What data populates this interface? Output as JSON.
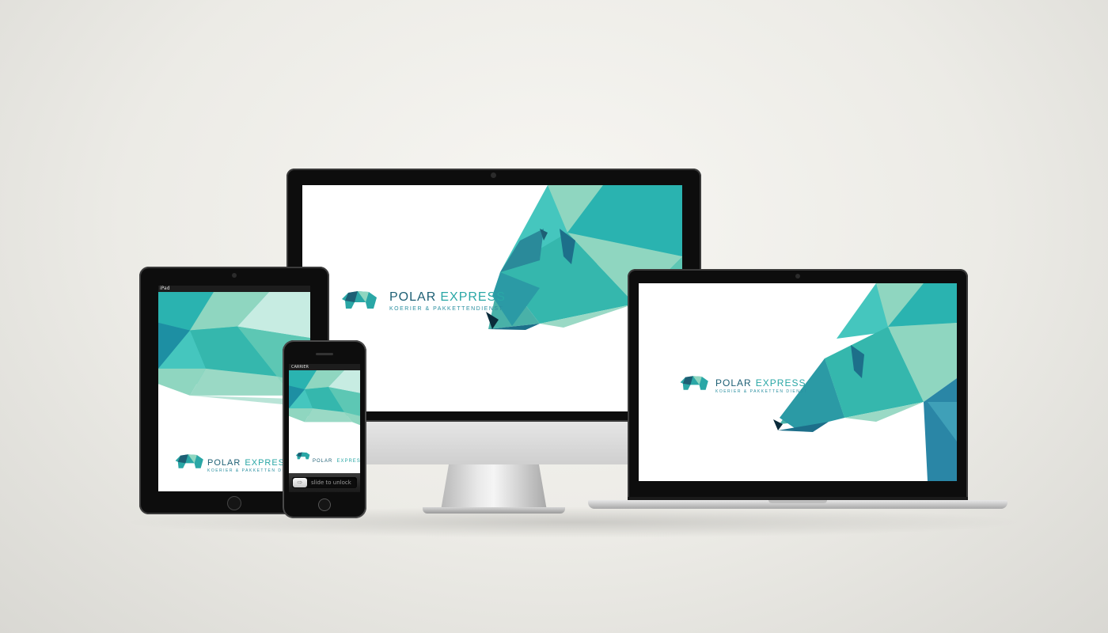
{
  "brand": {
    "name_word1": "POLAR",
    "name_word2": "EXPRESS",
    "tagline_long": "KOERIER & PAKKETTENDIENST",
    "tagline_short": "KOERIER & PAKKETTEN DIENST"
  },
  "iphone": {
    "carrier": "CARRIER",
    "slider_label": "slide to unlock"
  },
  "ipad": {
    "carrier": "iPad"
  },
  "colors": {
    "dark_teal": "#1d5f74",
    "teal": "#2aa7a6",
    "mint": "#8fd6c0",
    "aqua": "#45c6be"
  }
}
